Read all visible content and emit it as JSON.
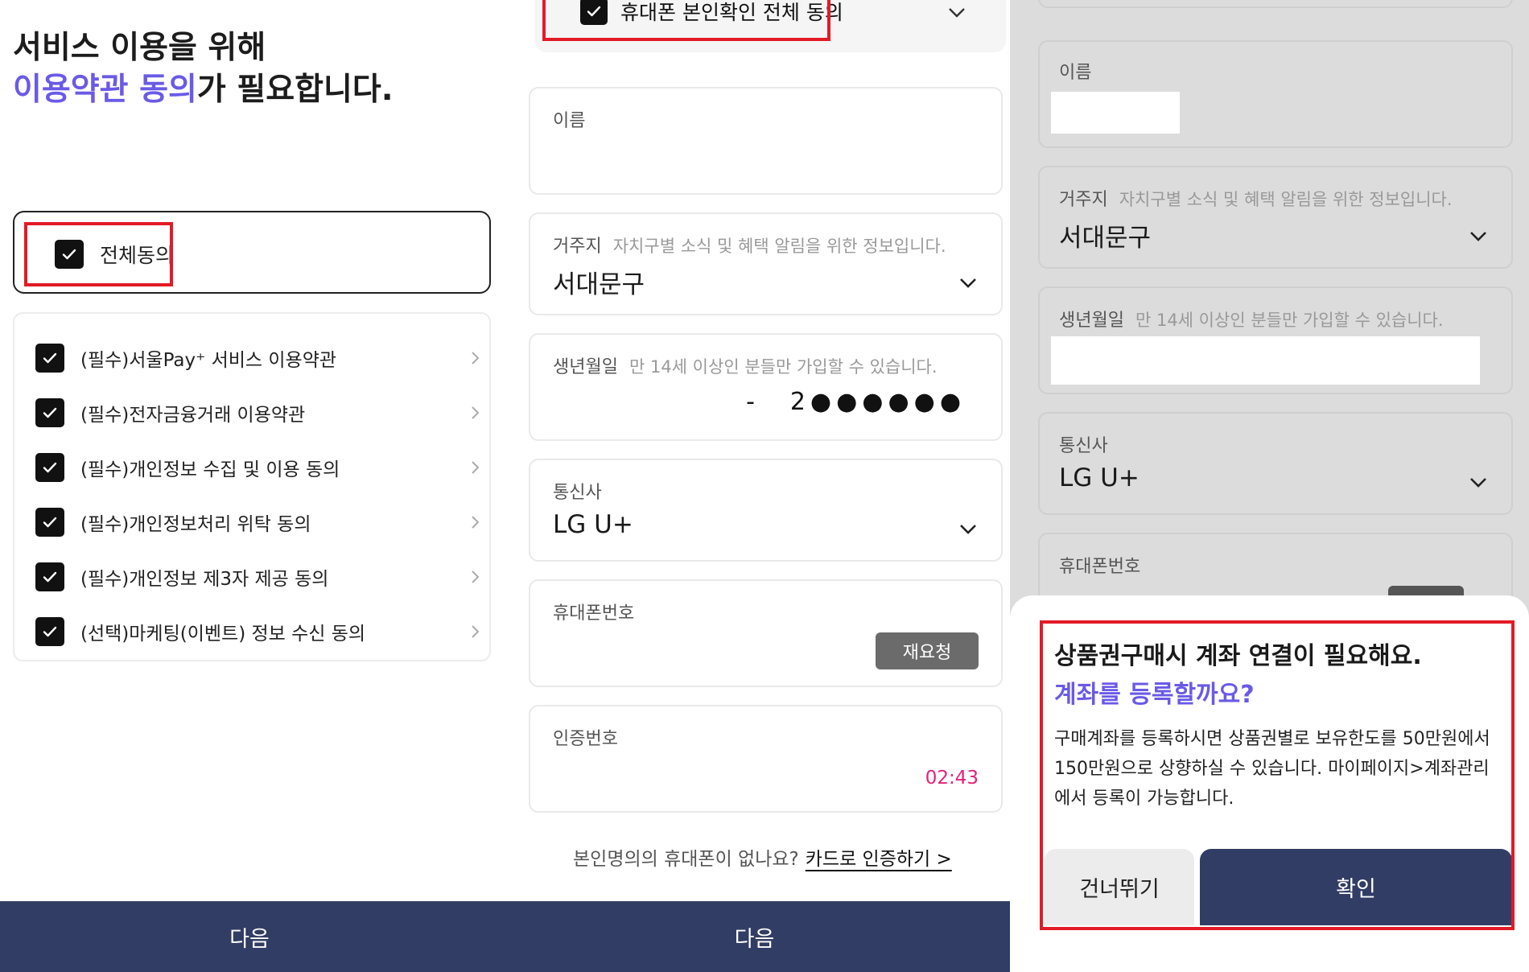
{
  "panel1": {
    "title_line1": "서비스 이용을 위해",
    "title_accent": "이용약관 동의",
    "title_rest": "가 필요합니다.",
    "agree_all": "전체동의",
    "items": [
      "(필수)서울Pay⁺ 서비스 이용약관",
      "(필수)전자금융거래 이용약관",
      "(필수)개인정보 수집 및 이용 동의",
      "(필수)개인정보처리 위탁 동의",
      "(필수)개인정보 제3자 제공 동의",
      "(선택)마케팅(이벤트) 정보 수신 동의"
    ],
    "next": "다음"
  },
  "panel2": {
    "phone_verify_all": "휴대폰 본인확인 전체 동의",
    "name_label": "이름",
    "address_label": "거주지",
    "address_hint": "자치구별 소식 및 혜택 알림을 위한 정보입니다.",
    "address_value": "서대문구",
    "birth_label": "생년월일",
    "birth_hint": "만 14세 이상인 분들만 가입할 수 있습니다.",
    "birth_dash": "-",
    "birth_masked": "2●●●●●●",
    "carrier_label": "통신사",
    "carrier_value": "LG U+",
    "phone_label": "휴대폰번호",
    "resend": "재요청",
    "code_label": "인증번호",
    "timer": "02:43",
    "no_phone_text": "본인명의의 휴대폰이 없나요?",
    "card_auth_link": "카드로 인증하기 >",
    "next": "다음"
  },
  "panel3": {
    "name_label": "이름",
    "address_label": "거주지",
    "address_hint": "자치구별 소식 및 혜택 알림을 위한 정보입니다.",
    "address_value": "서대문구",
    "birth_label": "생년월일",
    "birth_hint": "만 14세 이상인 분들만 가입할 수 있습니다.",
    "carrier_label": "통신사",
    "carrier_value": "LG U+",
    "phone_label": "휴대폰번호",
    "modal_title": "상품권구매시 계좌 연결이 필요해요.",
    "modal_question": "계좌를 등록할까요?",
    "modal_body": "구매계좌를 등록하시면 상품권별로 보유한도를 50만원에서 150만원으로 상향하실 수 있습니다. 마이페이지>계좌관리에서 등록이 가능합니다.",
    "skip": "건너뛰기",
    "confirm": "확인"
  },
  "colors": {
    "accent": "#6a5ae6",
    "primary_button": "#323d65",
    "highlight_red": "#e21b26",
    "timer": "#e4217a"
  }
}
